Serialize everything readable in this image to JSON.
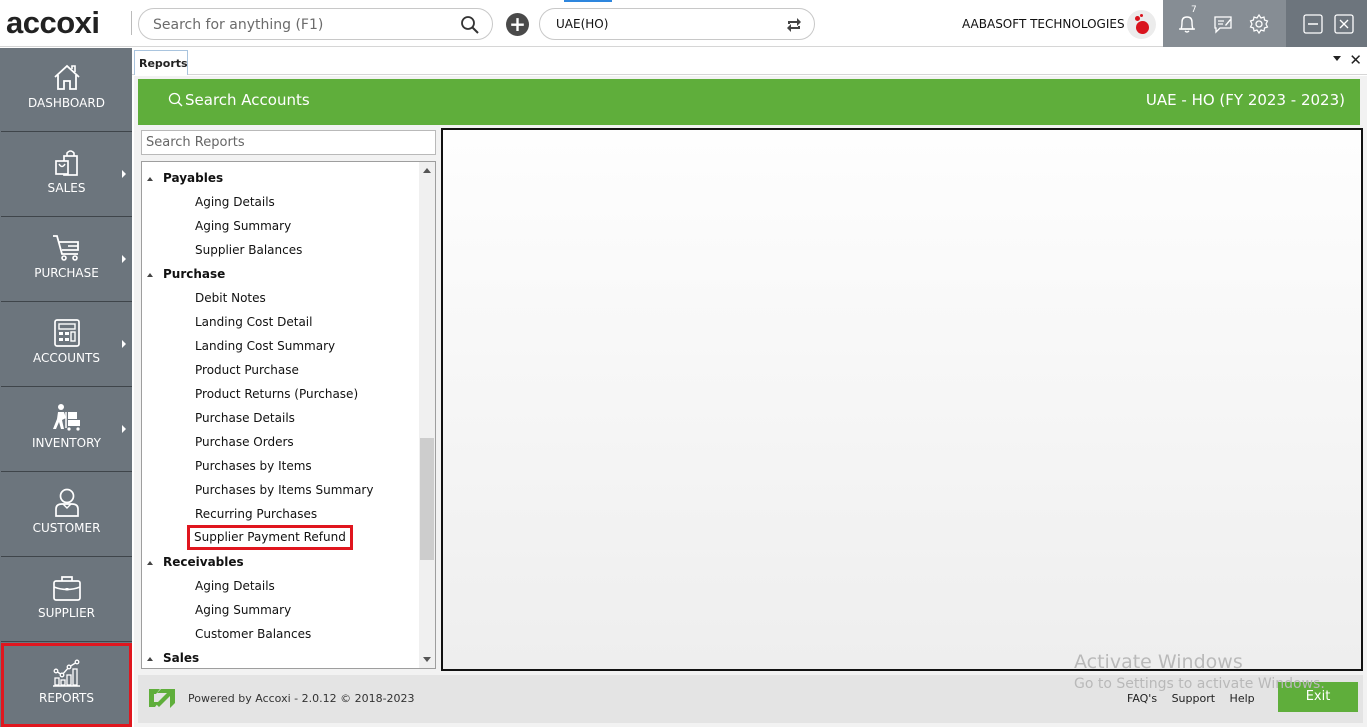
{
  "app": {
    "logo_text": "accoxi",
    "global_search_placeholder": "Search for anything (F1)",
    "branch": "UAE(HO)",
    "company_name": "AABASOFT TECHNOLOGIES",
    "notification_count": "7"
  },
  "sidebar": {
    "items": [
      {
        "label": "DASHBOARD",
        "icon": "home-icon",
        "has_submenu": false
      },
      {
        "label": "SALES",
        "icon": "shopping-bag-icon",
        "has_submenu": true
      },
      {
        "label": "PURCHASE",
        "icon": "cart-icon",
        "has_submenu": true
      },
      {
        "label": "ACCOUNTS",
        "icon": "calculator-icon",
        "has_submenu": true
      },
      {
        "label": "INVENTORY",
        "icon": "trolley-worker-icon",
        "has_submenu": true
      },
      {
        "label": "CUSTOMER",
        "icon": "user-icon",
        "has_submenu": false
      },
      {
        "label": "SUPPLIER",
        "icon": "briefcase-icon",
        "has_submenu": false
      },
      {
        "label": "REPORTS",
        "icon": "chart-icon",
        "has_submenu": false,
        "highlighted": true
      }
    ]
  },
  "tabs": {
    "active": "Reports"
  },
  "header": {
    "search_accounts_label": "Search Accounts",
    "company_fy": "UAE - HO (FY 2023 - 2023)"
  },
  "reports": {
    "search_placeholder": "Search Reports",
    "tree": [
      {
        "type": "group",
        "label": "Payables"
      },
      {
        "type": "leaf",
        "label": "Aging Details"
      },
      {
        "type": "leaf",
        "label": "Aging Summary"
      },
      {
        "type": "leaf",
        "label": "Supplier Balances"
      },
      {
        "type": "group",
        "label": "Purchase"
      },
      {
        "type": "leaf",
        "label": "Debit Notes"
      },
      {
        "type": "leaf",
        "label": "Landing Cost Detail"
      },
      {
        "type": "leaf",
        "label": "Landing Cost Summary"
      },
      {
        "type": "leaf",
        "label": "Product Purchase"
      },
      {
        "type": "leaf",
        "label": "Product Returns (Purchase)"
      },
      {
        "type": "leaf",
        "label": "Purchase Details"
      },
      {
        "type": "leaf",
        "label": "Purchase Orders"
      },
      {
        "type": "leaf",
        "label": "Purchases by Items"
      },
      {
        "type": "leaf",
        "label": "Purchases by Items Summary"
      },
      {
        "type": "leaf",
        "label": "Recurring Purchases"
      },
      {
        "type": "leaf",
        "label": "Supplier Payment Refund",
        "selected": true
      },
      {
        "type": "group",
        "label": "Receivables"
      },
      {
        "type": "leaf",
        "label": "Aging Details"
      },
      {
        "type": "leaf",
        "label": "Aging Summary"
      },
      {
        "type": "leaf",
        "label": "Customer Balances"
      },
      {
        "type": "group",
        "label": "Sales"
      }
    ]
  },
  "footer": {
    "powered_by": "Powered by Accoxi - 2.0.12 © 2018-2023",
    "links": [
      "FAQ's",
      "Support",
      "Help"
    ],
    "exit_label": "Exit"
  },
  "watermark": {
    "line1": "Activate Windows",
    "line2": "Go to Settings to activate Windows."
  },
  "colors": {
    "brand_green": "#5fae3b",
    "sidebar_bg": "#6c757d",
    "highlight_red": "#e0161e"
  }
}
